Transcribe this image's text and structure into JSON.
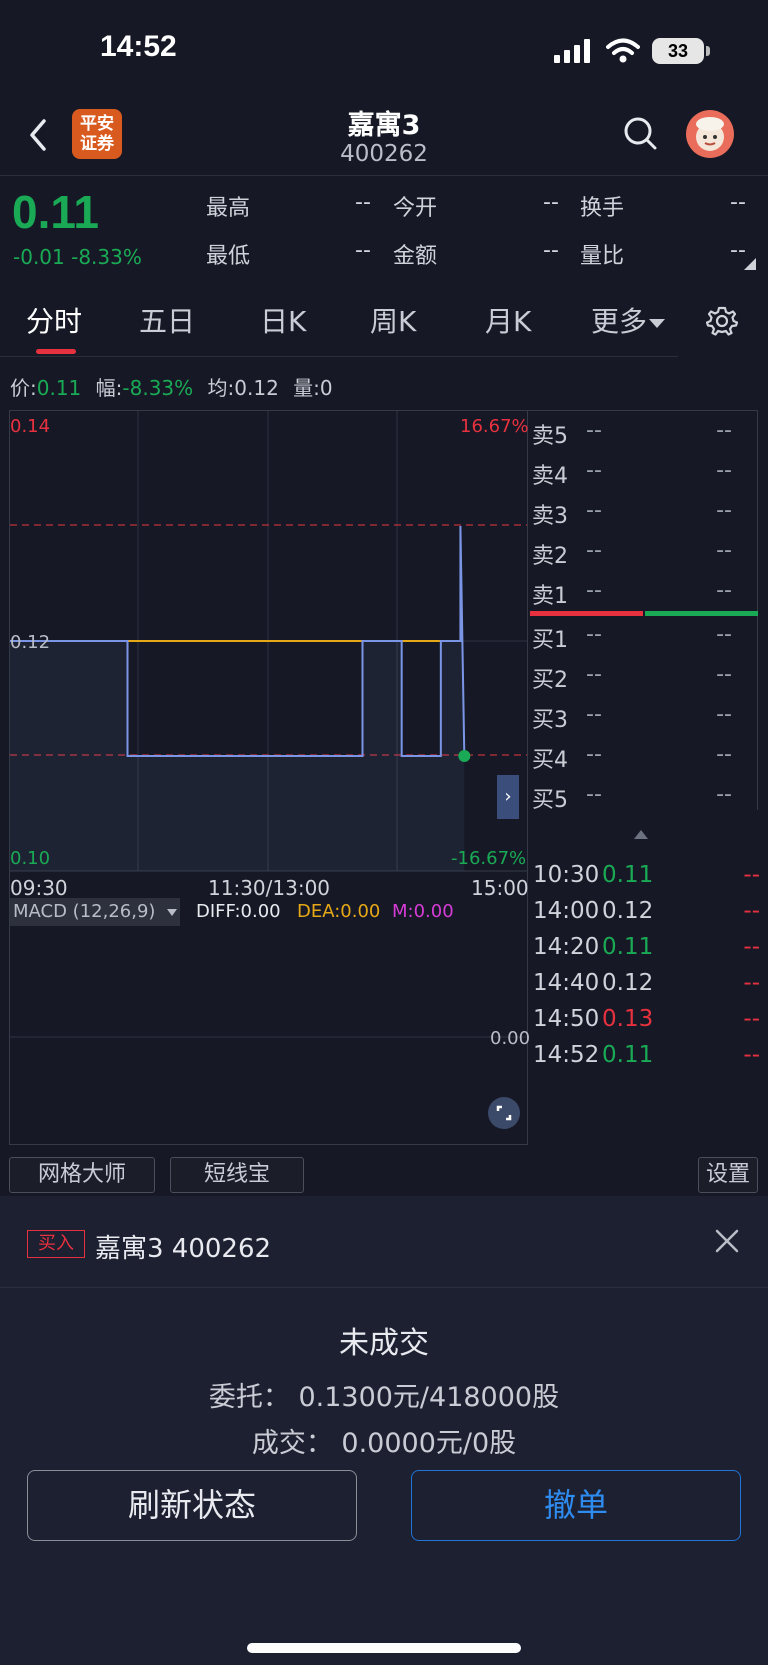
{
  "status_bar": {
    "time": "14:52",
    "battery": "33"
  },
  "header": {
    "broker_logo": [
      "平安",
      "证券"
    ],
    "title": "嘉寓3",
    "code": "400262"
  },
  "quote": {
    "price": "0.11",
    "change": "-0.01 -8.33%",
    "fields": [
      {
        "label": "最高",
        "value": "--"
      },
      {
        "label": "今开",
        "value": "--"
      },
      {
        "label": "换手",
        "value": "--"
      },
      {
        "label": "最低",
        "value": "--"
      },
      {
        "label": "金额",
        "value": "--"
      },
      {
        "label": "量比",
        "value": "--"
      }
    ]
  },
  "tabs": [
    "分时",
    "五日",
    "日K",
    "周K",
    "月K",
    "更多"
  ],
  "info_line": {
    "price_label": "价:",
    "price": "0.11",
    "range_label": "幅:",
    "range": "-8.33%",
    "avg_label": "均:",
    "avg": "0.12",
    "vol_label": "量:",
    "vol": "0"
  },
  "chart": {
    "y_top": "0.14",
    "y_mid": "0.12",
    "y_bottom": "0.10",
    "pct_top": "16.67%",
    "pct_bottom": "-16.67%",
    "x_labels": [
      "09:30",
      "11:30/13:00",
      "15:00"
    ],
    "macd": {
      "label": "MACD (12,26,9)",
      "diff": "DIFF:0.00",
      "dea": "DEA:0.00",
      "m": "M:0.00",
      "zero": "0.00"
    }
  },
  "chart_data": {
    "type": "line",
    "x_range": [
      "09:30",
      "15:00"
    ],
    "ylim": [
      0.1,
      0.14
    ],
    "series": [
      {
        "values_note": "",
        "points": [
          [
            "09:30",
            0.12
          ],
          [
            "10:30",
            0.12
          ],
          [
            "10:30",
            0.11
          ],
          [
            "14:00",
            0.11
          ],
          [
            "14:00",
            0.12
          ],
          [
            "14:20",
            0.12
          ],
          [
            "14:20",
            0.11
          ],
          [
            "14:40",
            0.11
          ],
          [
            "14:40",
            0.12
          ],
          [
            "14:50",
            0.12
          ],
          [
            "14:50",
            0.13
          ],
          [
            "14:52",
            0.11
          ]
        ]
      }
    ],
    "average_line": 0.12,
    "colors": {
      "price": "#7b95e6",
      "average": "#e6a817"
    }
  },
  "order_book": {
    "asks": [
      {
        "label": "卖5",
        "price": "--",
        "vol": "--"
      },
      {
        "label": "卖4",
        "price": "--",
        "vol": "--"
      },
      {
        "label": "卖3",
        "price": "--",
        "vol": "--"
      },
      {
        "label": "卖2",
        "price": "--",
        "vol": "--"
      },
      {
        "label": "卖1",
        "price": "--",
        "vol": "--"
      }
    ],
    "bids": [
      {
        "label": "买1",
        "price": "--",
        "vol": "--"
      },
      {
        "label": "买2",
        "price": "--",
        "vol": "--"
      },
      {
        "label": "买3",
        "price": "--",
        "vol": "--"
      },
      {
        "label": "买4",
        "price": "--",
        "vol": "--"
      },
      {
        "label": "买5",
        "price": "--",
        "vol": "--"
      }
    ]
  },
  "ticks": [
    {
      "time": "10:30",
      "price": "0.11",
      "color": "#1aaa55",
      "vol": "--"
    },
    {
      "time": "14:00",
      "price": "0.12",
      "color": "#d0d3da",
      "vol": "--"
    },
    {
      "time": "14:20",
      "price": "0.11",
      "color": "#1aaa55",
      "vol": "--"
    },
    {
      "time": "14:40",
      "price": "0.12",
      "color": "#d0d3da",
      "vol": "--"
    },
    {
      "time": "14:50",
      "price": "0.13",
      "color": "#e8313f",
      "vol": "--"
    },
    {
      "time": "14:52",
      "price": "0.11",
      "color": "#1aaa55",
      "vol": "--"
    }
  ],
  "tools": {
    "grid_master": "网格大师",
    "short_line": "短线宝",
    "settings": "设置"
  },
  "order_sheet": {
    "tag": "买入",
    "stock": "嘉寓3 400262",
    "status": "未成交",
    "entrust": "委托：  0.1300元/418000股",
    "deal": "成交：  0.0000元/0股",
    "refresh": "刷新状态",
    "cancel": "撤单"
  }
}
